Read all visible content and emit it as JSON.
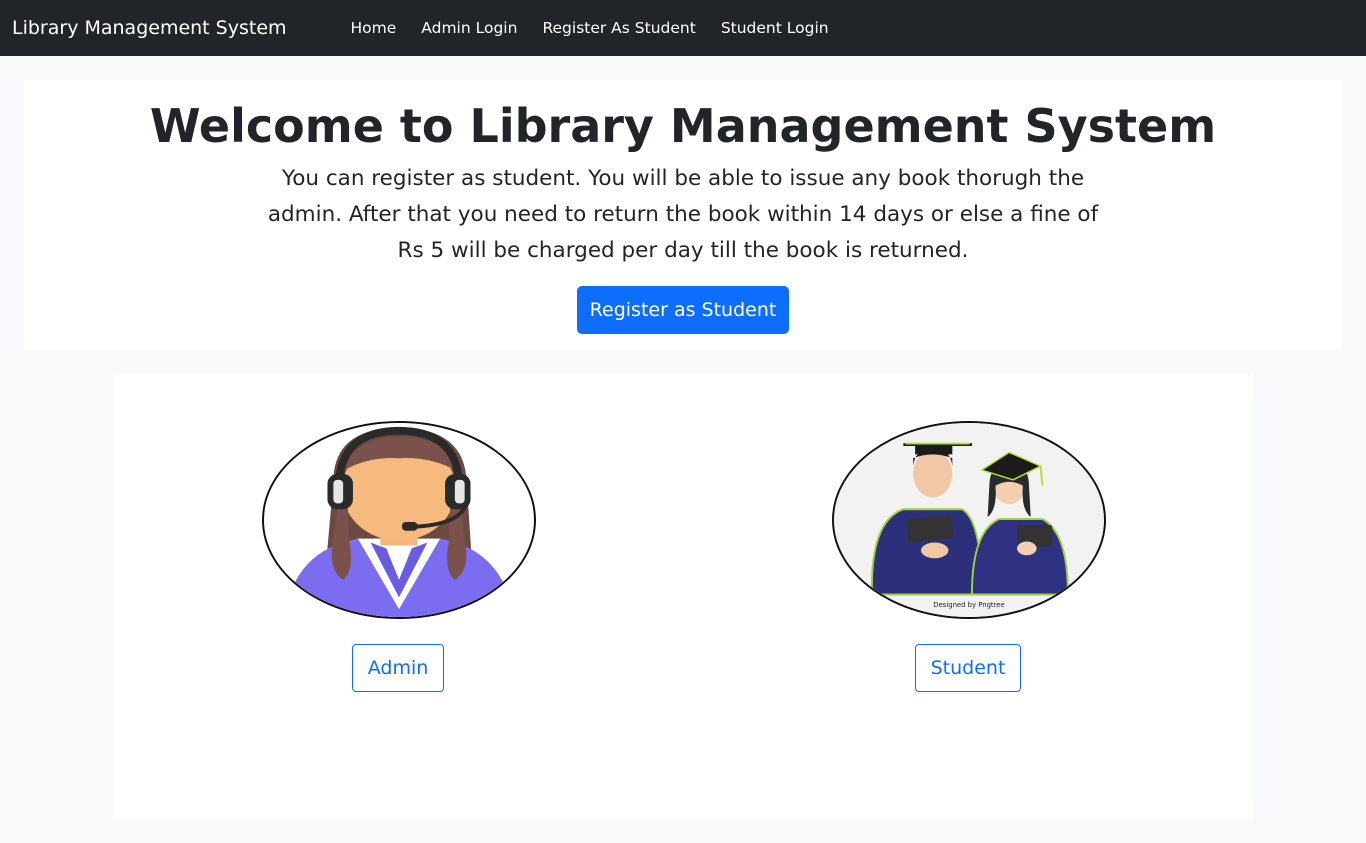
{
  "navbar": {
    "brand": "Library Management System",
    "links": [
      {
        "label": "Home"
      },
      {
        "label": "Admin Login"
      },
      {
        "label": "Register As Student"
      },
      {
        "label": "Student Login"
      }
    ]
  },
  "hero": {
    "title": "Welcome to Library Management System",
    "description": "You can register as student. You will be able to issue any book thorugh the admin. After that you need to return the book within 14 days or else a fine of Rs 5 will be charged per day till the book is returned.",
    "register_button": "Register as Student"
  },
  "cards": {
    "admin": {
      "image_icon": "admin-avatar-headset",
      "button_label": "Admin"
    },
    "student": {
      "image_icon": "students-graduates",
      "watermark": "Designed by Pngtree",
      "button_label": "Student"
    }
  },
  "colors": {
    "navbar_bg": "#212529",
    "primary": "#0d6efd",
    "page_bg": "#f8f9fa",
    "card_bg": "#ffffff"
  }
}
